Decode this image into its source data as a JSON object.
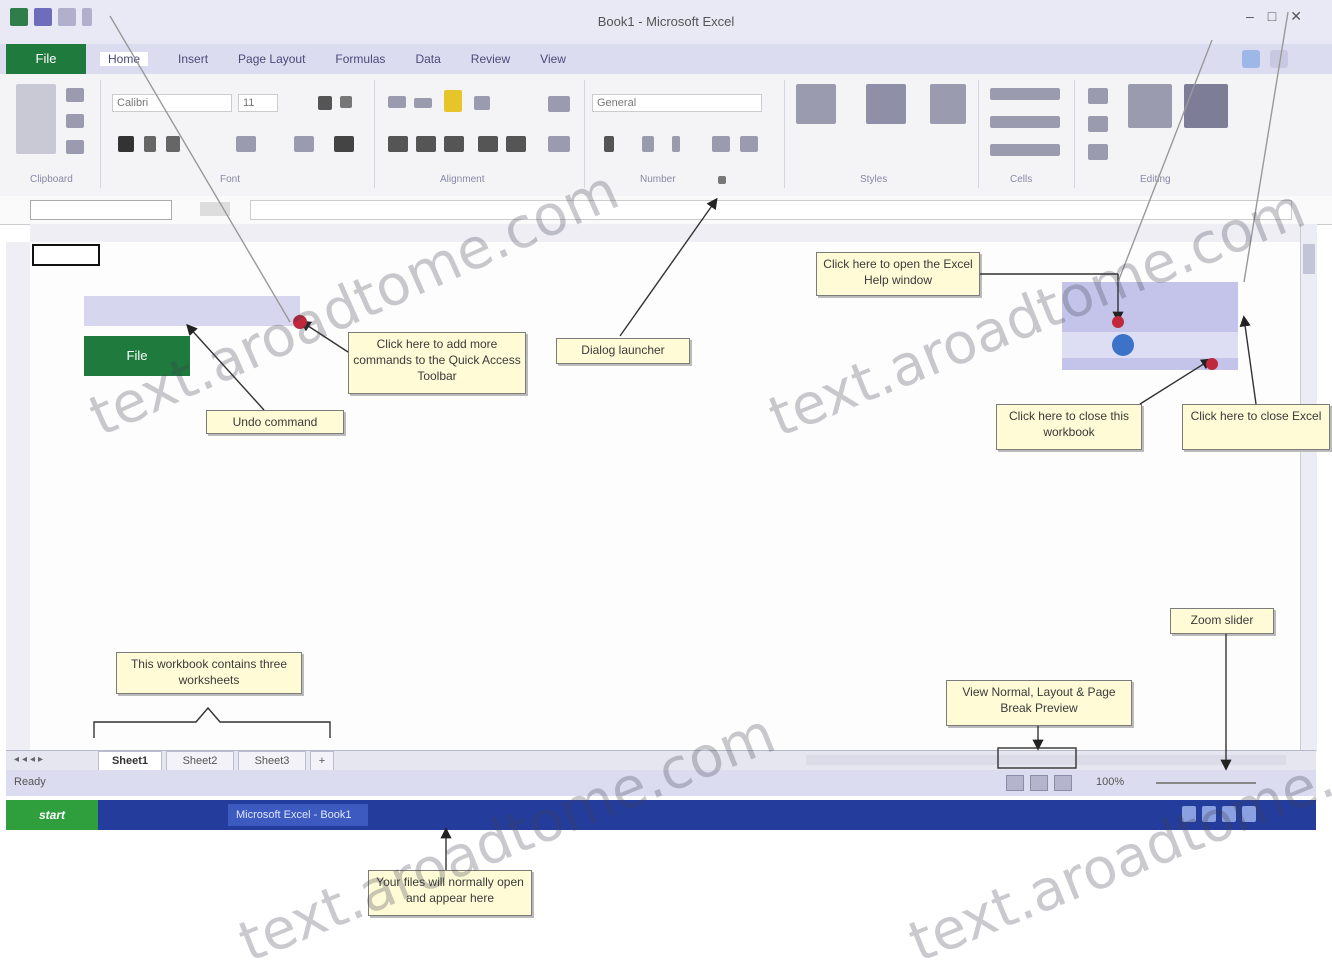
{
  "window": {
    "title": "Book1 - Microsoft Excel",
    "controls": [
      "–",
      "□",
      "✕"
    ]
  },
  "ribbon": {
    "file_tab": "File",
    "tabs": [
      "Home",
      "Insert",
      "Page Layout",
      "Formulas",
      "Data",
      "Review",
      "View"
    ],
    "groups": [
      "Clipboard",
      "Font",
      "Alignment",
      "Number",
      "Styles",
      "Cells",
      "Editing"
    ],
    "font_name": "Calibri",
    "font_size": "11",
    "number_format": "General"
  },
  "sheet": {
    "tabs": [
      "Sheet1",
      "Sheet2",
      "Sheet3"
    ],
    "active_tab": "Sheet1"
  },
  "status": {
    "ready": "Ready",
    "zoom": "100%"
  },
  "taskbar": {
    "start": "start",
    "item": "Microsoft Excel - Book1"
  },
  "inset_left": {
    "file_label": "File"
  },
  "callouts": {
    "qat_add": "Click here to add more commands to the Quick Access Toolbar",
    "undo": "Undo command",
    "dialog_launcher": "Dialog launcher",
    "ribbon_minimize": "Click here to open the Excel Help window",
    "close_workbook": "Click here to close this workbook",
    "close_excel": "Click here to close Excel",
    "three_sheets": "This workbook contains three worksheets",
    "view_buttons": "View Normal, Layout & Page Break Preview",
    "zoom_slider": "Zoom slider",
    "taskbar_note": "Your files will normally open and appear here"
  },
  "watermark": "text.aroadtome.com",
  "colors": {
    "file_tab": "#1e7a3d",
    "callout_bg": "#fefbd6",
    "taskbar": "#243d9c",
    "start": "#2f9e3d"
  }
}
